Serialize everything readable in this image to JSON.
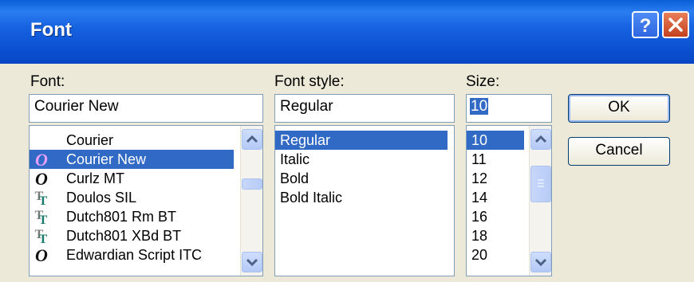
{
  "window": {
    "title": "Font"
  },
  "font": {
    "label": "Font:",
    "value": "Courier New",
    "items": [
      {
        "name": "Courier",
        "icon": "none"
      },
      {
        "name": "Courier New",
        "icon": "opentype-icon",
        "selected": true
      },
      {
        "name": "Curlz MT",
        "icon": "opentype-icon"
      },
      {
        "name": "Doulos SIL",
        "icon": "truetype-icon"
      },
      {
        "name": "Dutch801 Rm BT",
        "icon": "truetype-icon"
      },
      {
        "name": "Dutch801 XBd BT",
        "icon": "truetype-icon"
      },
      {
        "name": "Edwardian Script ITC",
        "icon": "opentype-icon"
      }
    ]
  },
  "style": {
    "label": "Font style:",
    "value": "Regular",
    "items": [
      {
        "name": "Regular",
        "selected": true
      },
      {
        "name": "Italic"
      },
      {
        "name": "Bold"
      },
      {
        "name": "Bold Italic"
      }
    ]
  },
  "size": {
    "label": "Size:",
    "value": "10",
    "items": [
      {
        "name": "10",
        "selected": true
      },
      {
        "name": "11"
      },
      {
        "name": "12"
      },
      {
        "name": "14"
      },
      {
        "name": "16"
      },
      {
        "name": "18"
      },
      {
        "name": "20"
      }
    ]
  },
  "buttons": {
    "ok": "OK",
    "cancel": "Cancel"
  },
  "colors": {
    "selection": "#316ac5",
    "titlebar": "#0a5fd8",
    "face": "#ece9d8"
  }
}
